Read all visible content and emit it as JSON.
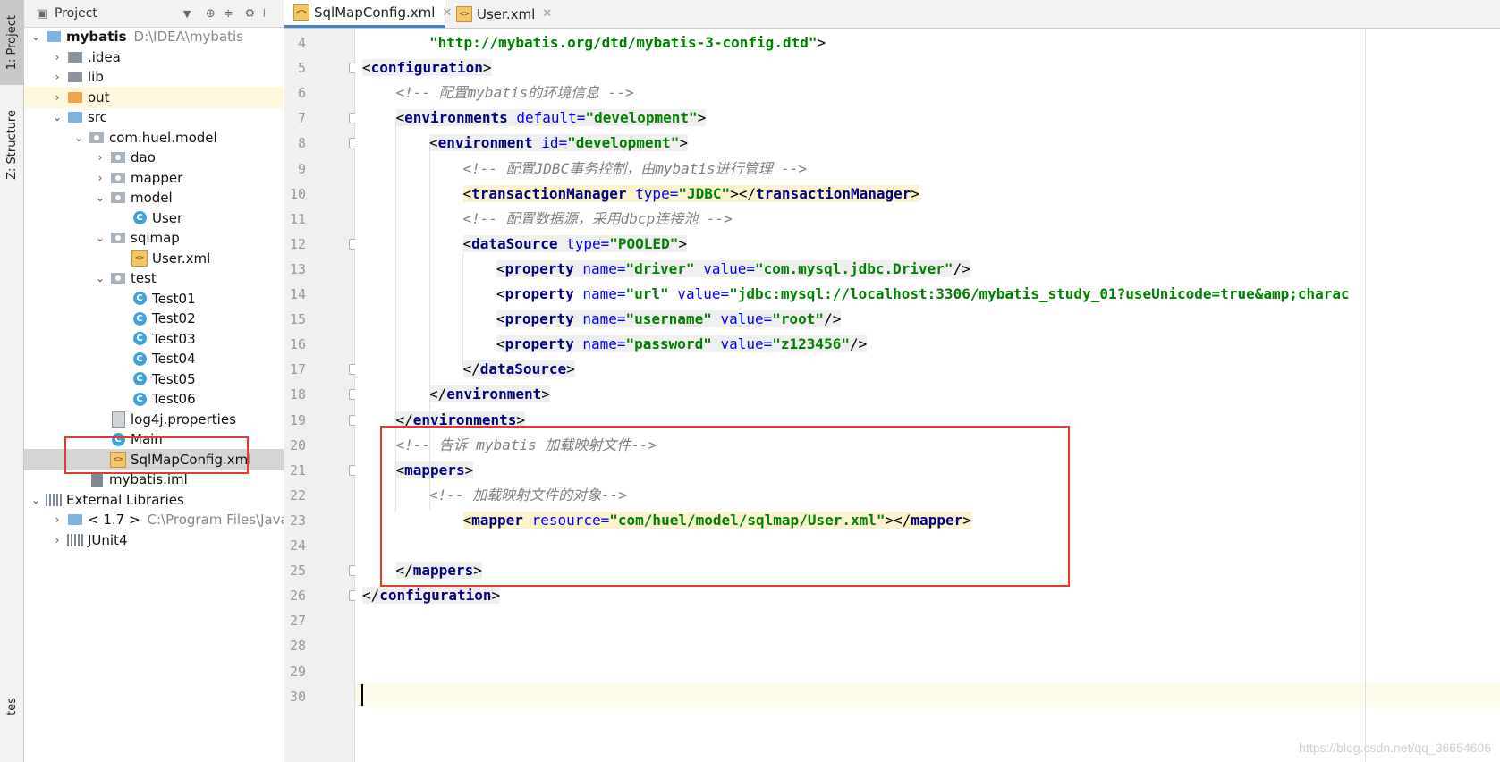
{
  "toolstrip": {
    "project_tab": "1: Project",
    "structure_tab": "Z: Structure",
    "bottom_tab": "tes"
  },
  "project_panel": {
    "header_title": "Project",
    "tree": [
      {
        "label": "mybatis",
        "extra": "D:\\IDEA\\mybatis",
        "icon": "module-folder-icon"
      },
      {
        "label": ".idea",
        "icon": "folder-icon"
      },
      {
        "label": "lib",
        "icon": "folder-icon"
      },
      {
        "label": "out",
        "icon": "excluded-folder-icon"
      },
      {
        "label": "src",
        "icon": "source-folder-icon"
      },
      {
        "label": "com.huel.model",
        "icon": "package-icon"
      },
      {
        "label": "dao",
        "icon": "package-icon"
      },
      {
        "label": "mapper",
        "icon": "package-icon"
      },
      {
        "label": "model",
        "icon": "package-icon"
      },
      {
        "label": "User",
        "icon": "class-icon"
      },
      {
        "label": "sqlmap",
        "icon": "package-icon"
      },
      {
        "label": "User.xml",
        "icon": "xml-file-icon"
      },
      {
        "label": "test",
        "icon": "package-icon"
      },
      {
        "label": "Test01",
        "icon": "class-icon"
      },
      {
        "label": "Test02",
        "icon": "class-icon"
      },
      {
        "label": "Test03",
        "icon": "class-icon"
      },
      {
        "label": "Test04",
        "icon": "class-icon"
      },
      {
        "label": "Test05",
        "icon": "class-icon"
      },
      {
        "label": "Test06",
        "icon": "class-icon"
      },
      {
        "label": "log4j.properties",
        "icon": "properties-file-icon"
      },
      {
        "label": "Main",
        "icon": "class-icon"
      },
      {
        "label": "SqlMapConfig.xml",
        "icon": "xml-file-icon"
      },
      {
        "label": "mybatis.iml",
        "icon": "iml-file-icon"
      },
      {
        "label": "External Libraries",
        "icon": "library-icon"
      },
      {
        "label": "< 1.7 >",
        "extra": "C:\\Program Files\\Java\\jd",
        "icon": "jdk-icon"
      },
      {
        "label": "JUnit4",
        "icon": "library-icon"
      }
    ]
  },
  "editor_tabs": [
    {
      "label": "SqlMapConfig.xml",
      "active": true
    },
    {
      "label": "User.xml",
      "active": false
    }
  ],
  "editor": {
    "lines": [
      {
        "n": "4",
        "tokens": [
          [
            "str",
            "\"http://mybatis.org/dtd/mybatis-3-config.dtd\""
          ],
          [
            "pl",
            ">"
          ]
        ]
      },
      {
        "n": "5",
        "tokens": [
          [
            "tag",
            "<"
          ],
          [
            "kwt",
            "configuration"
          ],
          [
            "tag",
            ">"
          ]
        ]
      },
      {
        "n": "6",
        "tokens": [
          [
            "cm",
            "<!-- 配置mybatis的环境信息 -->"
          ]
        ]
      },
      {
        "n": "7",
        "tokens": [
          [
            "tag",
            "<"
          ],
          [
            "kwt",
            "environments"
          ],
          [
            "at",
            " default="
          ],
          [
            "str",
            "\"development\""
          ],
          [
            "tag",
            ">"
          ]
        ]
      },
      {
        "n": "8",
        "tokens": [
          [
            "tag",
            "<"
          ],
          [
            "kwt",
            "environment"
          ],
          [
            "at",
            " id="
          ],
          [
            "str",
            "\"development\""
          ],
          [
            "tag",
            ">"
          ]
        ]
      },
      {
        "n": "9",
        "tokens": [
          [
            "cm",
            "<!-- 配置JDBC事务控制，由mybatis进行管理 -->"
          ]
        ]
      },
      {
        "n": "10",
        "tokens": [
          [
            "ytag",
            "<"
          ],
          [
            "ykw",
            "transactionManager"
          ],
          [
            "yat",
            " type="
          ],
          [
            "ystr",
            "\"JDBC\""
          ],
          [
            "ytag",
            "></"
          ],
          [
            "ykw",
            "transactionManager"
          ],
          [
            "ytag",
            ">"
          ]
        ]
      },
      {
        "n": "11",
        "tokens": [
          [
            "cm",
            "<!-- 配置数据源，采用dbcp连接池 -->"
          ]
        ]
      },
      {
        "n": "12",
        "tokens": [
          [
            "tag",
            "<"
          ],
          [
            "kwt",
            "dataSource"
          ],
          [
            "at",
            " type="
          ],
          [
            "str",
            "\"POOLED\""
          ],
          [
            "tag",
            ">"
          ]
        ]
      },
      {
        "n": "13",
        "tokens": [
          [
            "tag",
            "<"
          ],
          [
            "kwt",
            "property"
          ],
          [
            "at",
            " name="
          ],
          [
            "str",
            "\"driver\""
          ],
          [
            "at",
            " value="
          ],
          [
            "str",
            "\"com.mysql.jdbc.Driver\""
          ],
          [
            "tag",
            "/>"
          ]
        ]
      },
      {
        "n": "14",
        "tokens": [
          [
            "tag",
            "<"
          ],
          [
            "kwt",
            "property"
          ],
          [
            "at",
            " name="
          ],
          [
            "str",
            "\"url\""
          ],
          [
            "at",
            " value="
          ],
          [
            "str",
            "\"jdbc:mysql://localhost:3306/mybatis_study_01?useUnicode=true&amp;charac"
          ]
        ]
      },
      {
        "n": "15",
        "tokens": [
          [
            "tag",
            "<"
          ],
          [
            "kwt",
            "property"
          ],
          [
            "at",
            " name="
          ],
          [
            "str",
            "\"username\""
          ],
          [
            "at",
            " value="
          ],
          [
            "str",
            "\"root\""
          ],
          [
            "tag",
            "/>"
          ]
        ]
      },
      {
        "n": "16",
        "tokens": [
          [
            "tag",
            "<"
          ],
          [
            "kwt",
            "property"
          ],
          [
            "at",
            " name="
          ],
          [
            "str",
            "\"password\""
          ],
          [
            "at",
            " value="
          ],
          [
            "str",
            "\"z123456\""
          ],
          [
            "tag",
            "/>"
          ]
        ]
      },
      {
        "n": "17",
        "tokens": [
          [
            "tag",
            "</"
          ],
          [
            "kwt",
            "dataSource"
          ],
          [
            "tag",
            ">"
          ]
        ]
      },
      {
        "n": "18",
        "tokens": [
          [
            "tag",
            "</"
          ],
          [
            "kwt",
            "environment"
          ],
          [
            "tag",
            ">"
          ]
        ]
      },
      {
        "n": "19",
        "tokens": [
          [
            "tag",
            "</"
          ],
          [
            "kwt",
            "environments"
          ],
          [
            "tag",
            ">"
          ]
        ]
      },
      {
        "n": "20",
        "tokens": [
          [
            "cm",
            "<!-- 告诉 mybatis 加载映射文件-->"
          ]
        ]
      },
      {
        "n": "21",
        "tokens": [
          [
            "tag",
            "<"
          ],
          [
            "kwt",
            "mappers"
          ],
          [
            "tag",
            ">"
          ]
        ]
      },
      {
        "n": "22",
        "tokens": [
          [
            "cm",
            "<!-- 加载映射文件的对象-->"
          ]
        ]
      },
      {
        "n": "23",
        "tokens": [
          [
            "ytag",
            "<"
          ],
          [
            "ykw",
            "mapper"
          ],
          [
            "yat",
            " resource="
          ],
          [
            "ystr",
            "\"com/huel/model/sqlmap/User.xml\""
          ],
          [
            "ytag",
            "></"
          ],
          [
            "ykw",
            "mapper"
          ],
          [
            "ytag",
            ">"
          ]
        ]
      },
      {
        "n": "24",
        "tokens": []
      },
      {
        "n": "25",
        "tokens": [
          [
            "tag",
            "</"
          ],
          [
            "kwt",
            "mappers"
          ],
          [
            "tag",
            ">"
          ]
        ]
      },
      {
        "n": "26",
        "tokens": [
          [
            "tag",
            "</"
          ],
          [
            "kwt",
            "configuration"
          ],
          [
            "tag",
            ">"
          ]
        ]
      },
      {
        "n": "27",
        "tokens": []
      },
      {
        "n": "28",
        "tokens": []
      },
      {
        "n": "29",
        "tokens": []
      },
      {
        "n": "30",
        "tokens": []
      }
    ]
  },
  "watermark": "https://blog.csdn.net/qq_36654606"
}
